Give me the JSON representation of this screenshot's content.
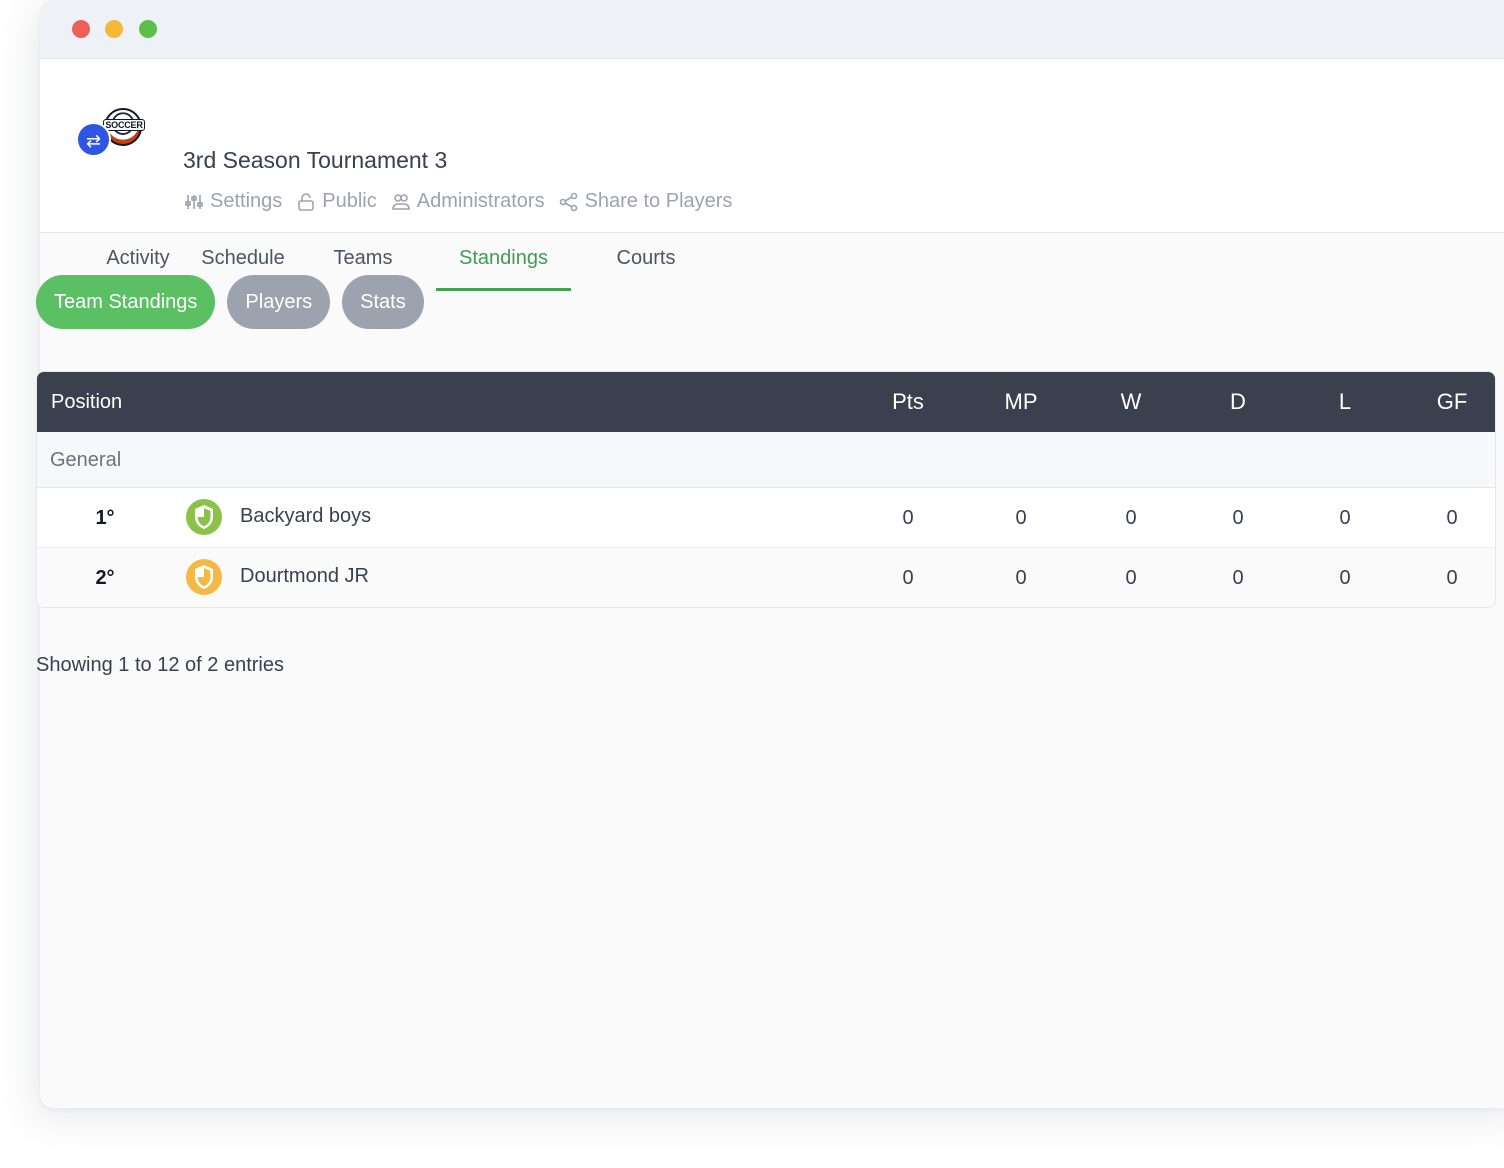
{
  "window": {
    "controls": [
      "close",
      "minimize",
      "zoom"
    ]
  },
  "tournament": {
    "logo_text": "SOCCER",
    "switch_icon": "swap-icon",
    "title": "3rd Season Tournament 3",
    "links": [
      {
        "label": "Settings",
        "icon": "sliders-icon"
      },
      {
        "label": "Public",
        "icon": "lock-icon"
      },
      {
        "label": "Administrators",
        "icon": "users-icon"
      },
      {
        "label": "Share to Players",
        "icon": "share-icon"
      }
    ]
  },
  "tabs": [
    {
      "label": "Activity",
      "active": false
    },
    {
      "label": "Schedule",
      "active": false
    },
    {
      "label": "Teams",
      "active": false
    },
    {
      "label": "Standings",
      "active": true
    },
    {
      "label": "Courts",
      "active": false
    }
  ],
  "subtabs": [
    {
      "label": "Team Standings",
      "active": true
    },
    {
      "label": "Players",
      "active": false
    },
    {
      "label": "Stats",
      "active": false
    }
  ],
  "standings": {
    "columns": [
      "Position",
      "Pts",
      "MP",
      "W",
      "D",
      "L",
      "GF"
    ],
    "group": "General",
    "rows": [
      {
        "rank": "1°",
        "team": "Backyard boys",
        "badge_color": "#8bc34a",
        "values": [
          "0",
          "0",
          "0",
          "0",
          "0",
          "0"
        ]
      },
      {
        "rank": "2°",
        "team": "Dourtmond JR",
        "badge_color": "#f4b942",
        "values": [
          "0",
          "0",
          "0",
          "0",
          "0",
          "0"
        ]
      }
    ]
  },
  "pagination": {
    "prefix": "Showing",
    "from": "1",
    "to_word": "to",
    "to": "12",
    "of_word": "of",
    "total": "2",
    "suffix": "entries"
  },
  "colors": {
    "accent_green": "#43a34f",
    "pill_green": "#5bbf64",
    "pill_gray": "#9ca3af",
    "table_header": "#3b404e"
  }
}
